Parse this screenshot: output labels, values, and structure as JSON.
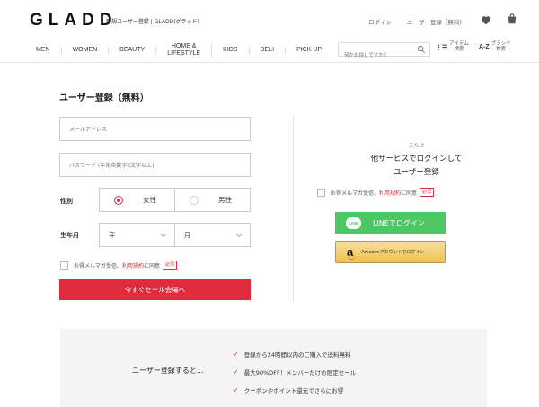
{
  "header": {
    "logo": "GLADD",
    "tagline": "新規ユーザー登録 | GLADD(グラッド)",
    "login_link": "ログイン",
    "register_link": "ユーザー登録（無料）"
  },
  "nav": {
    "items": [
      "MEN",
      "WOMEN",
      "BEAUTY",
      "HOME &\nLIFESTYLE",
      "KIDS",
      "DELI",
      "PICK UP"
    ]
  },
  "search": {
    "placeholder": "何かお探しですか？"
  },
  "tools": {
    "item_search": {
      "icon": "⋮☰",
      "label": "アイテム\n検索"
    },
    "brand_search": {
      "icon": "A-Z",
      "label": "ブランド\n検索"
    }
  },
  "form": {
    "title": "ユーザー登録（無料）",
    "email_placeholder": "メールアドレス",
    "password_placeholder": "パスワード (半角英数字6文字以上)",
    "gender_label": "性別",
    "gender_female": "女性",
    "gender_male": "男性",
    "gender_selected": "female",
    "birth_label": "生年月",
    "year_value": "年",
    "month_value": "月",
    "newsletter_text": "お得メルマガ受信、",
    "terms_link": "利用規約",
    "agree_text": "に同意",
    "required_badge": "必須",
    "submit_label": "今すぐセール会場へ"
  },
  "social": {
    "or_text": "または",
    "title_line1": "他サービスでログインして",
    "title_line2": "ユーザー登録",
    "newsletter_text": "お得メルマガ受信、",
    "terms_link": "利用規約",
    "agree_text": "に同意",
    "required_badge": "必須",
    "line_badge": "LINE",
    "line_label": "LINEでログイン",
    "amazon_label": "Amazonアカウントでログイン"
  },
  "benefits": {
    "lead": "ユーザー登録すると...",
    "items": [
      "登録から24時間以内のご購入で送料無料",
      "最大90%OFF！メンバーだけの限定セール",
      "クーポンやポイント還元でさらにお得"
    ]
  },
  "colors": {
    "accent_red": "#e02b3c",
    "line_green": "#4cc764",
    "amazon_gold": "#f0c14b"
  }
}
